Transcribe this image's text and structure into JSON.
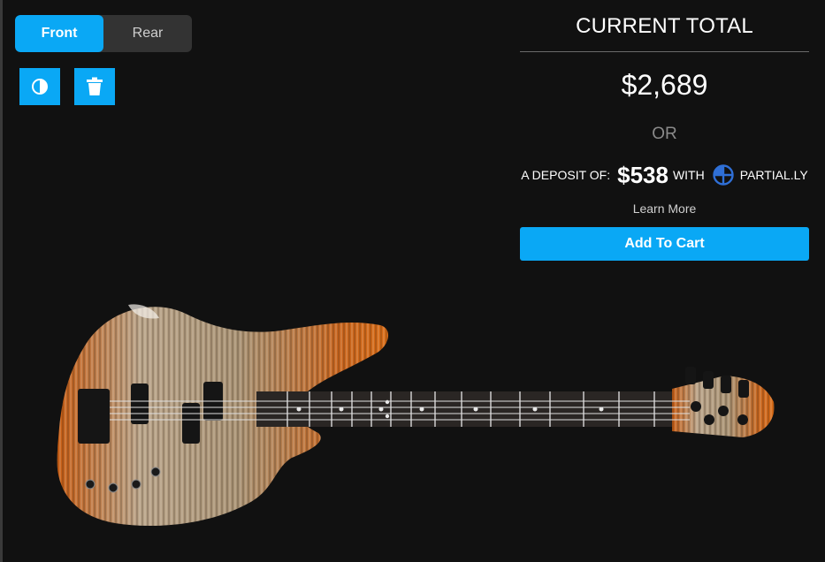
{
  "view_toggle": {
    "front_label": "Front",
    "rear_label": "Rear",
    "selected": "Front"
  },
  "tools": {
    "contrast_icon": "contrast-icon",
    "trash_icon": "trash-icon"
  },
  "summary": {
    "title": "CURRENT TOTAL",
    "price": "$2,689",
    "or_label": "OR",
    "deposit_prefix": "A DEPOSIT OF:",
    "deposit_amount": "$538",
    "deposit_with": "WITH",
    "partner_name": "PARTIAL.LY",
    "learn_more": "Learn More",
    "add_to_cart": "Add To Cart"
  },
  "colors": {
    "accent": "#0aa8f5",
    "background": "#111111",
    "toggle_bg": "#333333"
  }
}
